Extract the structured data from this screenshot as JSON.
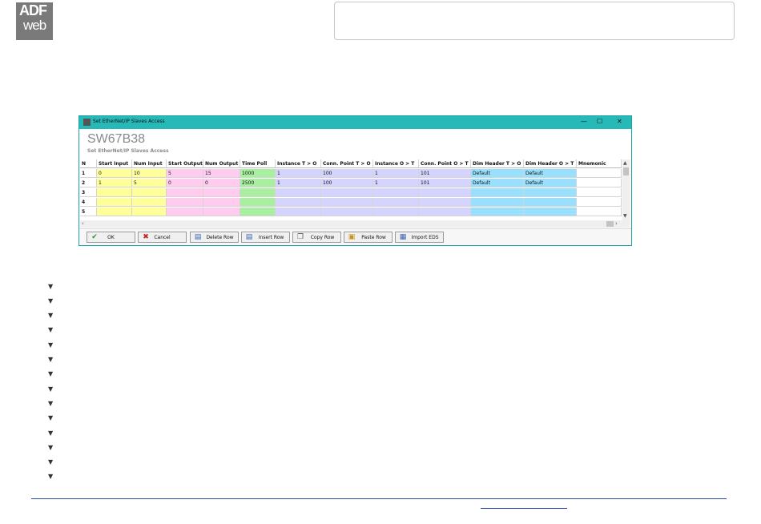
{
  "logo": {
    "line1": "ADF",
    "line2": "web"
  },
  "window": {
    "title": "Set EtherNet/IP Slaves Access",
    "controls": {
      "minimize": "—",
      "maximize": "☐",
      "close": "✕"
    },
    "banner_title": "SW67B38",
    "banner_subtitle": "Set EtherNet/IP Slaves Access"
  },
  "table": {
    "columns": [
      "N",
      "Start Input",
      "Num Input",
      "Start Output",
      "Num Output",
      "Time Poll",
      "Instance T > O",
      "Conn. Point T > O",
      "Instance O > T",
      "Conn. Point O > T",
      "Dim Header T > O",
      "Dim Header O > T",
      "Mnemonic"
    ],
    "rows": [
      [
        "1",
        "0",
        "10",
        "5",
        "15",
        "1000",
        "1",
        "100",
        "1",
        "101",
        "Default",
        "Default",
        ""
      ],
      [
        "2",
        "1",
        "5",
        "0",
        "0",
        "2500",
        "1",
        "100",
        "1",
        "101",
        "Default",
        "Default",
        ""
      ],
      [
        "3",
        "",
        "",
        "",
        "",
        "",
        "",
        "",
        "",
        "",
        "",
        "",
        ""
      ],
      [
        "4",
        "",
        "",
        "",
        "",
        "",
        "",
        "",
        "",
        "",
        "",
        "",
        ""
      ],
      [
        "5",
        "",
        "",
        "",
        "",
        "",
        "",
        "",
        "",
        "",
        "",
        "",
        ""
      ]
    ],
    "column_colors": [
      "#ffffff",
      "#ffff99",
      "#ffff99",
      "#ffccf0",
      "#ffccf0",
      "#a8f0a0",
      "#d4d4ff",
      "#d4d4ff",
      "#d4d4ff",
      "#d4d4ff",
      "#99e0ff",
      "#99e0ff",
      "#ffffff"
    ]
  },
  "buttons": {
    "ok": "OK",
    "cancel": "Cancel",
    "delete_row": "Delete Row",
    "insert_row": "Insert Row",
    "copy_row": "Copy Row",
    "paste_row": "Paste Row",
    "import_eds": "Import EDS"
  },
  "bullet_count": 14
}
